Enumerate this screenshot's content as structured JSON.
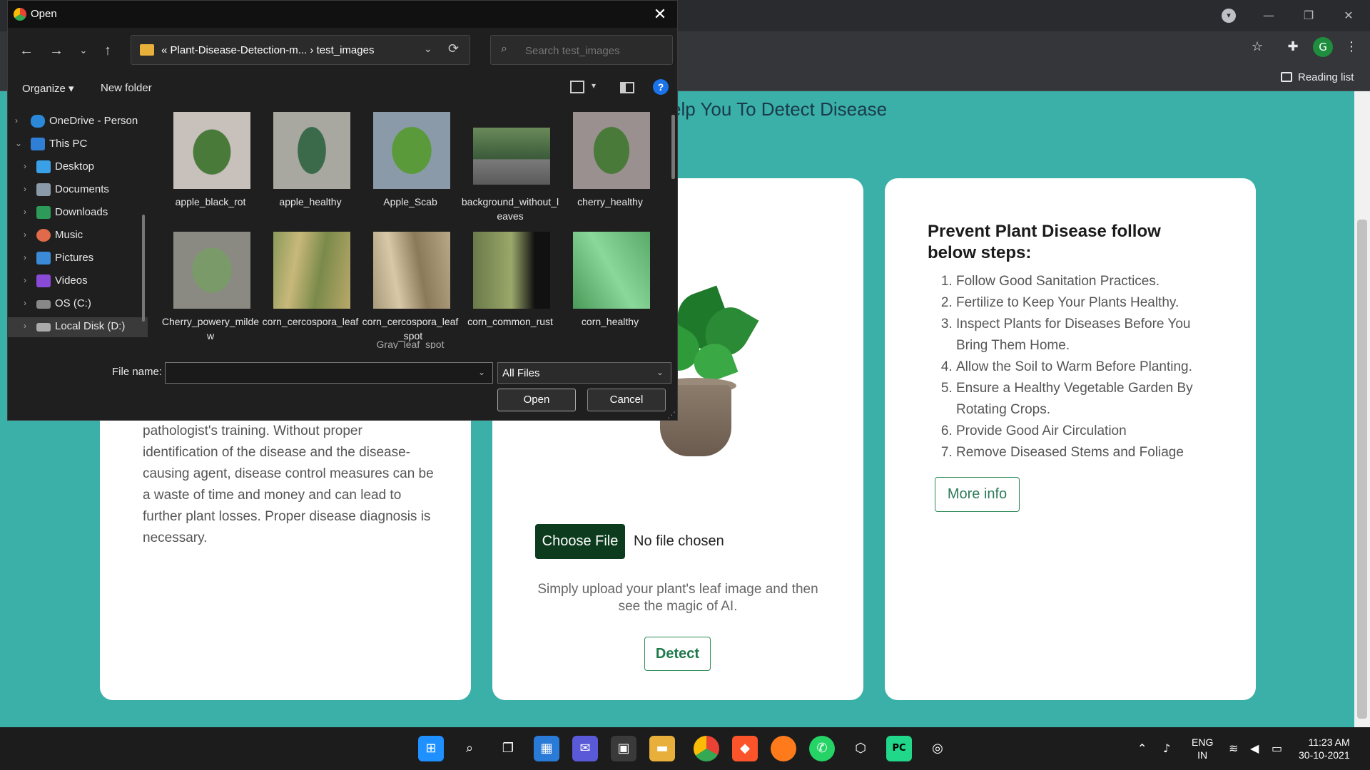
{
  "browser": {
    "reading_list": "Reading list",
    "avatar_letter": "G",
    "accent": "#202124"
  },
  "page": {
    "heading": "elp You To Detect Disease",
    "left_card_text": "pathologist's training. Without proper identification of the disease and the disease-causing agent, disease control measures can be a waste of time and money and can lead to further plant losses. Proper disease diagnosis is necessary.",
    "choose_file": "Choose File",
    "no_file": "No file chosen",
    "upload_hint": "Simply upload your plant's leaf image and then see the magic of AI.",
    "detect": "Detect",
    "steps_title": "Prevent Plant Disease follow below steps:",
    "steps": [
      "Follow Good Sanitation Practices.",
      "Fertilize to Keep Your Plants Healthy.",
      "Inspect Plants for Diseases Before You Bring Them Home.",
      "Allow the Soil to Warm Before Planting.",
      "Ensure a Healthy Vegetable Garden By Rotating Crops.",
      "Provide Good Air Circulation",
      "Remove Diseased Stems and Foliage"
    ],
    "more_info": "More info",
    "bg_color": "#3ab0a8"
  },
  "dialog": {
    "title": "Open",
    "path": "Plant-Disease-Detection-m...  ›  test_images",
    "path_prefix": "«",
    "search_placeholder": "Search test_images",
    "organize": "Organize ▾",
    "new_folder": "New folder",
    "nav": [
      {
        "label": "OneDrive - Person",
        "icon": "cloud-icon"
      },
      {
        "label": "This PC",
        "icon": "pc-icon"
      },
      {
        "label": "Desktop",
        "icon": "desktop-icon"
      },
      {
        "label": "Documents",
        "icon": "documents-icon"
      },
      {
        "label": "Downloads",
        "icon": "downloads-icon"
      },
      {
        "label": "Music",
        "icon": "music-icon"
      },
      {
        "label": "Pictures",
        "icon": "pictures-icon"
      },
      {
        "label": "Videos",
        "icon": "videos-icon"
      },
      {
        "label": "OS (C:)",
        "icon": "drive-icon"
      },
      {
        "label": "Local Disk (D:)",
        "icon": "drive-icon"
      }
    ],
    "files": [
      "apple_black_rot",
      "apple_healthy",
      "Apple_Scab",
      "background_without_leaves",
      "cherry_healthy",
      "Cherry_powery_mildew",
      "corn_cercospora_leaf",
      "corn_cercospora_leaf_spot",
      "corn_common_rust",
      "corn_healthy"
    ],
    "partial_file": "Gray_leaf_spot",
    "filename_label": "File name:",
    "filename_value": "",
    "filetype": "All Files",
    "open": "Open",
    "cancel": "Cancel"
  },
  "taskbar": {
    "lang_1": "ENG",
    "lang_2": "IN",
    "time": "11:23 AM",
    "date": "30-10-2021"
  }
}
